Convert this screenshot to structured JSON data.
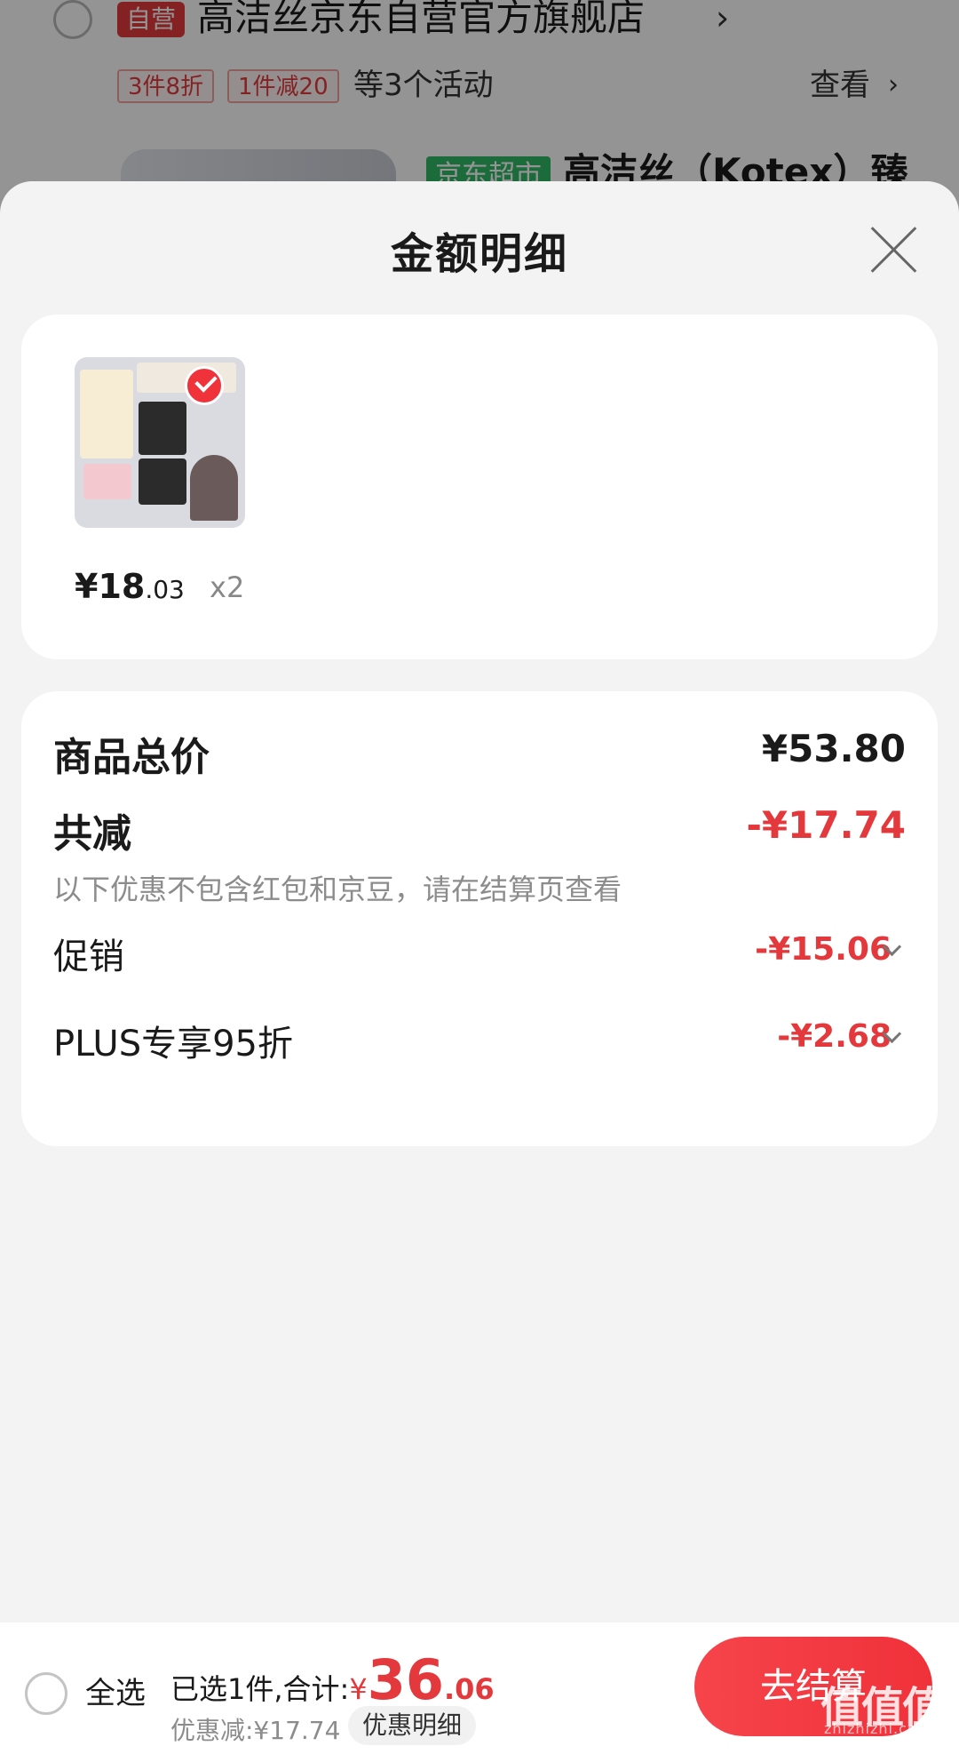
{
  "background_cart": {
    "self_run_tag": "自营",
    "store_name": "高洁丝京东自营官方旗舰店",
    "promo_tags": [
      "3件8折",
      "1件减20"
    ],
    "activity_text": "等3个活动",
    "view_label": "查看",
    "supermarket_tag": "京东超市",
    "product_name": "高洁丝（Kotex）臻"
  },
  "sheet": {
    "title": "金额明细"
  },
  "product": {
    "price_int": "¥18",
    "price_dec": ".03",
    "quantity": "x2"
  },
  "summary": {
    "total_label": "商品总价",
    "total_value": "¥53.80",
    "reduction_label": "共减",
    "reduction_value": "-¥17.74",
    "reduction_note": "以下优惠不包含红包和京豆，请在结算页查看",
    "items": [
      {
        "label": "促销",
        "value": "-¥15.06"
      },
      {
        "label": "PLUS专享95折",
        "value": "-¥2.68"
      }
    ]
  },
  "bottom_bar": {
    "select_all": "全选",
    "selected_text": "已选1件,合计:",
    "total_yen": "¥",
    "total_int": "36",
    "total_dec": ".06",
    "discount_text": "优惠减:¥17.74",
    "detail_button": "优惠明细",
    "checkout_button": "去结算",
    "watermark": "值值值",
    "watermark_url": "zhizhizhi.com"
  },
  "colors": {
    "accent_red": "#e4393c",
    "super_green": "#2fb866"
  }
}
